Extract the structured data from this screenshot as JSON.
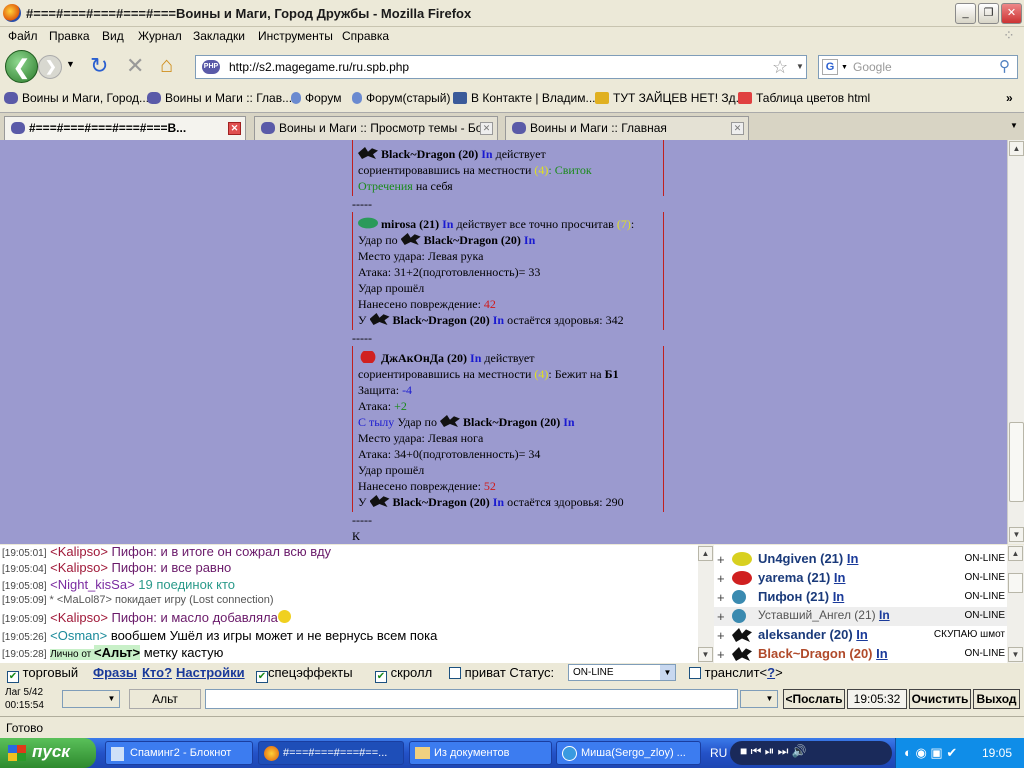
{
  "window": {
    "title": "#===#===#===#===#===Воины и Маги, Город Дружбы - Mozilla Firefox",
    "min": "_",
    "max": "❐",
    "close": "✕"
  },
  "menu": [
    "Файл",
    "Правка",
    "Вид",
    "Журнал",
    "Закладки",
    "Инструменты",
    "Справка"
  ],
  "nav": {
    "url": "http://s2.magegame.ru/ru.spb.php",
    "search_placeholder": "Google",
    "php": "PHP"
  },
  "bookmarks": [
    "Воины и Маги, Город...",
    "Воины и Маги :: Глав...",
    "Форум",
    "Форум(старый)",
    "В Контакте | Владим...",
    "ТУТ ЗАЙЦЕВ НЕТ! Зд...",
    "Таблица цветов html"
  ],
  "tabs": [
    "#===#===#===#===#===В...",
    "Воины и Маги :: Просмотр темы - Бо...",
    "Воины и Маги :: Главная"
  ],
  "log": {
    "b1_nick": "Black~Dragon (20)",
    "in": "In",
    "b1_act": "действует",
    "b1_l2a": "сориентировавшись на местности ",
    "b1_n": "(4)",
    "b1_l2b": ": Свиток",
    "b1_spell": "Отречения",
    "b1_l3": " на себя",
    "sep": "-----",
    "b2_nick": "mirosa (21)",
    "b2_act": " действует все точно просчитав ",
    "b2_n": "(7)",
    "b2_hit": "Удар по ",
    "b2_target": "Black~Dragon (20)",
    "b2_place": "Место удара: Левая рука",
    "b2_atk": "Атака: 31+2(подготовленность)= 33",
    "b2_pass": "Удар прошёл",
    "b2_dmg_l": "Нанесено повреждение: ",
    "b2_dmg": "42",
    "b2_hp_pre": "У ",
    "b2_hp_nick": "Black~Dragon (20)",
    "b2_hp_post": " остаётся здоровья: 342",
    "b3_nick": "ДжАкОнДа (20)",
    "b3_act": " действует",
    "b3_l2a": "сориентировавшись на местности ",
    "b3_n": "(4)",
    "b3_l2b": ": Бежит на ",
    "b3_loc": "Б1",
    "b3_def_l": "Защита: ",
    "b3_def": "-4",
    "b3_atk_l": "Атака: ",
    "b3_atk": "+2",
    "b3_from": "С тылу",
    "b3_hit": " Удар по ",
    "b3_target": "Black~Dragon (20)",
    "b3_place": "Место удара: Левая нога",
    "b3_atkcalc": "Атака: 34+0(подготовленность)= 34",
    "b3_pass": "Удар прошёл",
    "b3_dmg_l": "Нанесено повреждение: ",
    "b3_dmg": "52",
    "b3_hp_pre": "У ",
    "b3_hp_nick": "Black~Dragon (20)",
    "b3_hp_post": " остаётся здоровья: 290",
    "tail": "К"
  },
  "chat": [
    {
      "time": "[19:05:01]",
      "nick": "<Kalipso>",
      "text": " Пифон: и в итоге он сожрал всю вду"
    },
    {
      "time": "[19:05:04]",
      "nick": "<Kalipso>",
      "text": " Пифон: и все равно"
    },
    {
      "time": "[19:05:08]",
      "nick": "<Night_kisSa>",
      "text": " 19 поединок кто"
    },
    {
      "time": "[19:05:09]",
      "nick": "* <MaLol87>",
      "text": " покидает игру (Lost connection)"
    },
    {
      "time": "[19:05:09]",
      "nick": "<Kalipso>",
      "text": " Пифон: и масло добавляла"
    },
    {
      "time": "[19:05:26]",
      "nick": "<Osman>",
      "text": " вообшем Ушёл из игры может и не вернусь всем пока"
    },
    {
      "time": "[19:05:28]",
      "pm": "Лично от ",
      "nick": "<Альт>",
      "text": " метку кастую"
    }
  ],
  "users": [
    {
      "name": "Un4given (21)",
      "in": "In",
      "status": "ON-LINE"
    },
    {
      "name": "yarema (21)",
      "in": "In",
      "status": "ON-LINE"
    },
    {
      "name": "Пифон (21)",
      "in": "In",
      "status": "ON-LINE"
    },
    {
      "name": "Уставший_Ангел (21)",
      "in": "In",
      "status": "ON-LINE"
    },
    {
      "name": "aleksander (20)",
      "in": "In",
      "status": "СКУПАЮ шмот"
    },
    {
      "name": "Black~Dragon (20)",
      "in": "In",
      "status": "ON-LINE"
    }
  ],
  "controls": {
    "trade": "торговый",
    "phrases": "Фразы",
    "who": "Кто?",
    "settings": "Настройки",
    "effects": "спецэффекты",
    "scroll": "скролл",
    "private": "приват Статус:",
    "status_val": "ON-LINE",
    "translit": "транслит<",
    "q": "?",
    "gt": ">"
  },
  "input": {
    "lag": "Лаг 5/42",
    "time": "00:15:54",
    "alt": "Альт",
    "send": "<Послать",
    "clock": "19:05:32",
    "clear": "Очистить",
    "exit": "Выход"
  },
  "statusbar": "Готово",
  "taskbar": {
    "start": "пуск",
    "tasks": [
      "Спаминг2 - Блокнот",
      "#===#===#===#==...",
      "Из документов",
      "Миша(Sergo_zloy) ..."
    ],
    "lang": "RU",
    "clock": "19:05"
  }
}
